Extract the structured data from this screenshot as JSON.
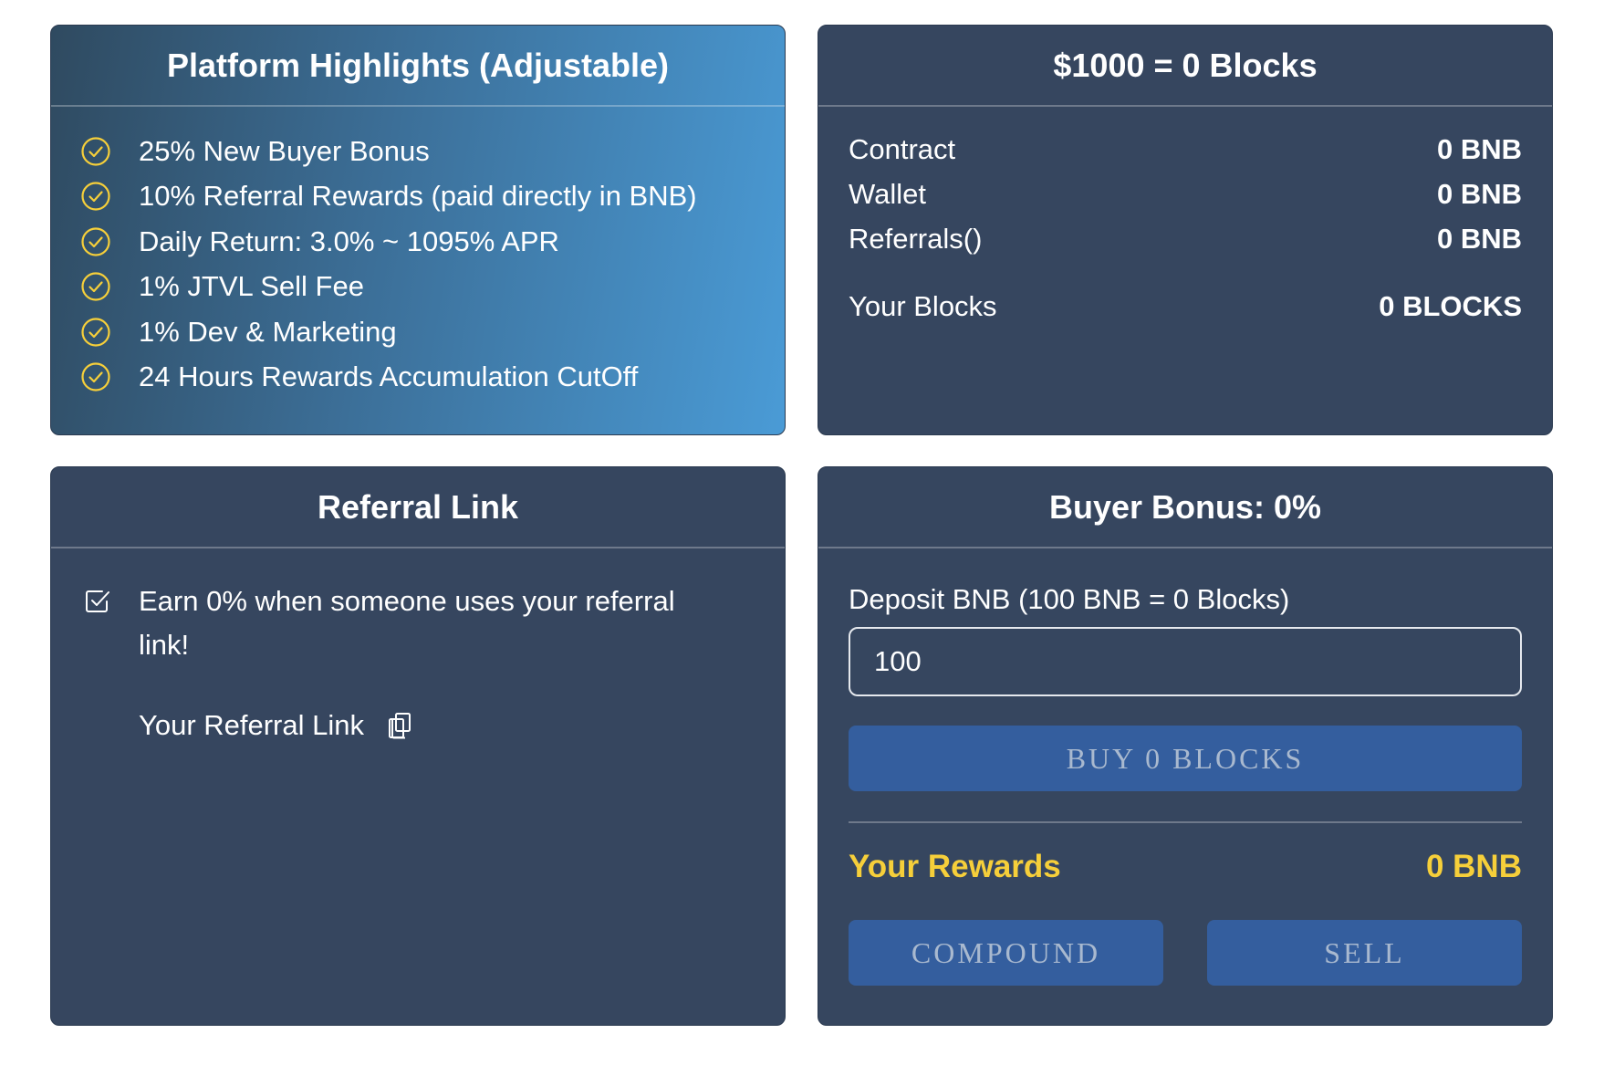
{
  "colors": {
    "card_bg": "#36465f",
    "accent_yellow": "#f6cf3a",
    "button_bg": "#345e9e",
    "button_text": "#a9b9cf",
    "highlight_gradient_end": "#4a9bd6"
  },
  "highlights": {
    "title": "Platform Highlights (Adjustable)",
    "icon": "check-circle-icon",
    "items": [
      "25% New Buyer Bonus",
      "10% Referral Rewards (paid directly in BNB)",
      "Daily Return: 3.0% ~ 1095% APR",
      "1% JTVL Sell Fee",
      "1% Dev & Marketing",
      "24 Hours Rewards Accumulation CutOff"
    ]
  },
  "stats": {
    "title": "$1000 = 0 Blocks",
    "rows": [
      {
        "label": "Contract",
        "value": "0 BNB"
      },
      {
        "label": "Wallet",
        "value": "0 BNB"
      },
      {
        "label": "Referrals()",
        "value": "0 BNB"
      }
    ],
    "blocks": {
      "label": "Your Blocks",
      "value": "0 BLOCKS"
    }
  },
  "referral": {
    "title": "Referral Link",
    "earn_text": "Earn 0% when someone uses your referral link!",
    "link_label": "Your Referral Link",
    "icons": [
      "checkbox-checked-icon",
      "copy-icon"
    ]
  },
  "buy": {
    "title": "Buyer Bonus: 0%",
    "deposit_label": "Deposit BNB (100 BNB = 0 Blocks)",
    "deposit_value": "100",
    "buy_button": "BUY 0 BLOCKS",
    "rewards_label": "Your Rewards",
    "rewards_value": "0 BNB",
    "compound_button": "COMPOUND",
    "sell_button": "SELL"
  }
}
